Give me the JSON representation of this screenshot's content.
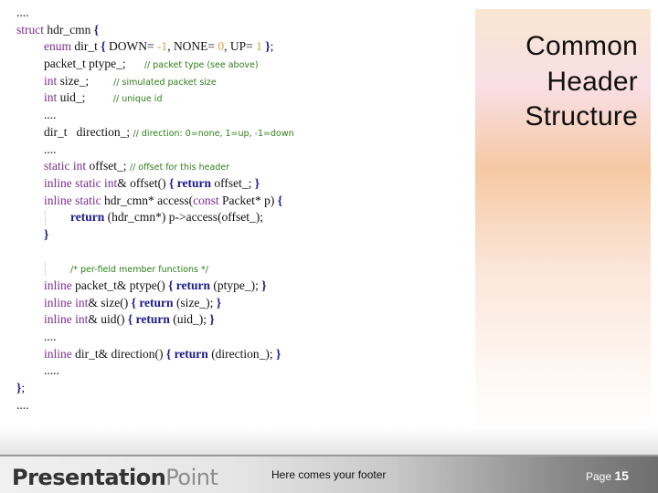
{
  "slide": {
    "title_lines": [
      "Common",
      "Header",
      "Structure"
    ]
  },
  "code": {
    "lines": [
      "....",
      "struct hdr_cmn {",
      "enum dir_t { DOWN= -1, NONE= 0, UP= 1 };",
      "packet_t ptype_;",
      "int size_;",
      "int uid_;",
      "....",
      "dir_t   direction_;",
      "....",
      "static int offset_;",
      "inline static int& offset() { return offset_; }",
      "inline static hdr_cmn* access(const Packet* p) {",
      "return (hdr_cmn*) p->access(offset_);",
      "}",
      "",
      "/* per-field member functions */",
      "inline packet_t& ptype() { return (ptype_); }",
      "inline int& size() { return (size_); }",
      "inline int& uid() { return (uid_); }",
      "....",
      "inline dir_t& direction() { return (direction_); }",
      ".....",
      "};",
      "...."
    ],
    "comments": {
      "ptype": "// packet type (see above)",
      "size": "// simulated packet size",
      "uid": "// unique id",
      "direction": "// direction: 0=none, 1=up, -1=down",
      "offset": "// offset for this header"
    }
  },
  "footer": {
    "logo_bold": "Presentation",
    "logo_light": "Point",
    "text": "Here comes your footer",
    "page_label": "Page",
    "page_number": "15"
  },
  "colors": {
    "keyword": "#7b2d8e",
    "return": "#1a1a8c",
    "number": "#d8a040",
    "comment": "#2e7d1a"
  }
}
